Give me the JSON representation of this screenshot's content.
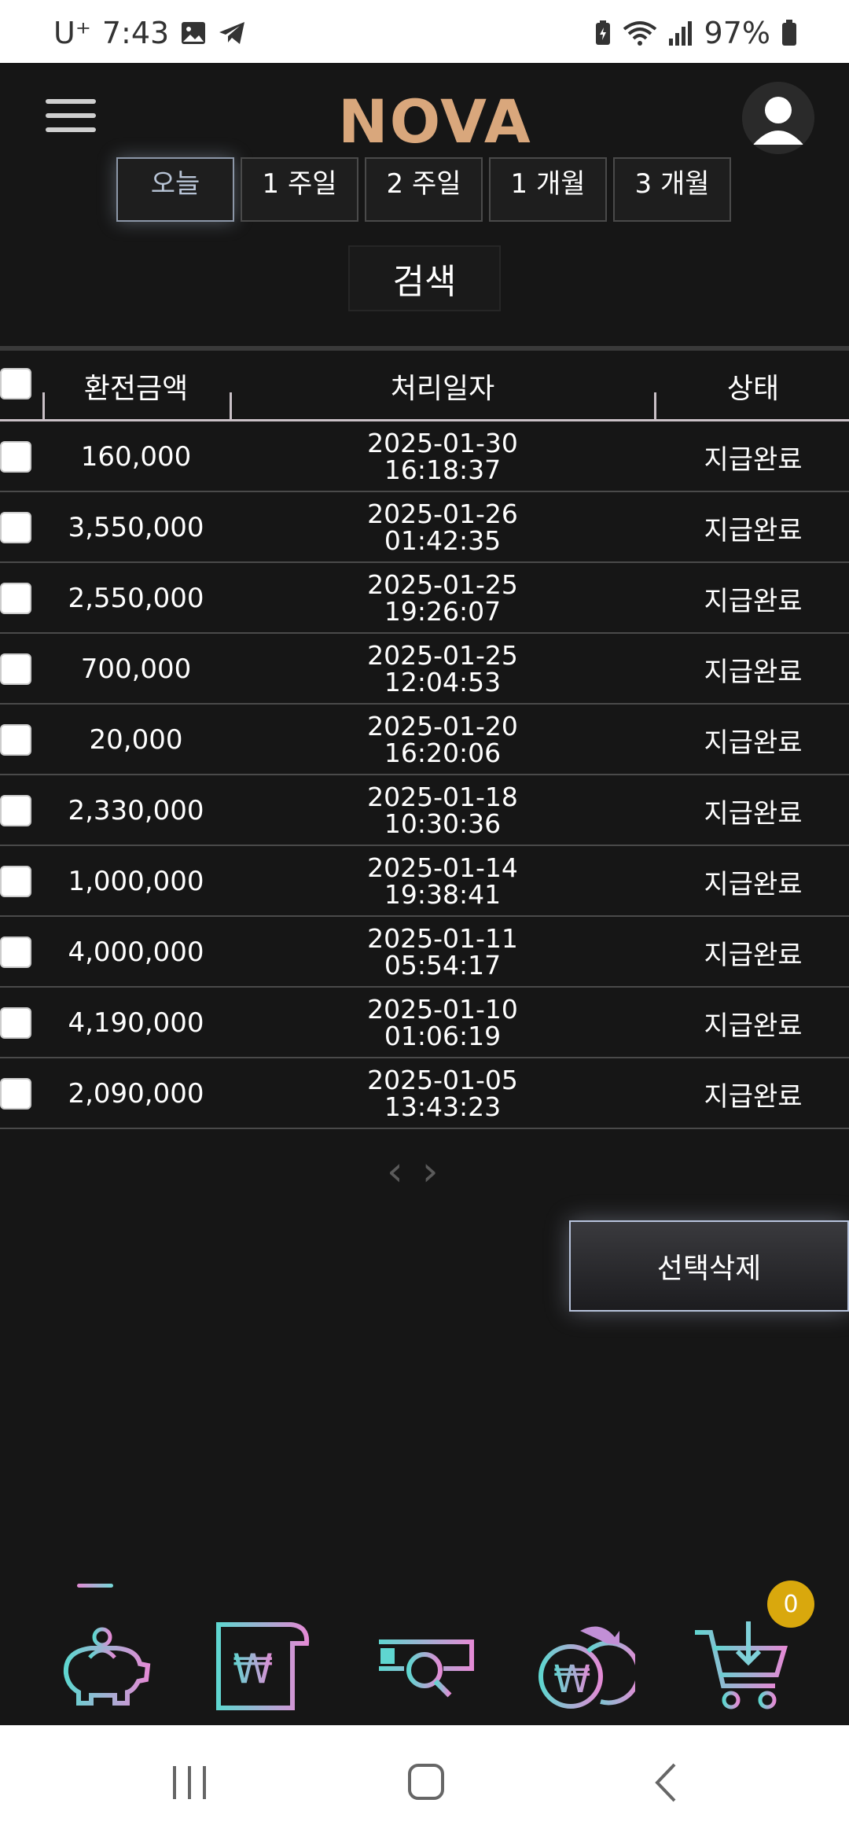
{
  "status_bar": {
    "carrier": "U⁺",
    "time": "7:43",
    "battery": "97%"
  },
  "header": {
    "logo_text": "NOVA"
  },
  "period_buttons": [
    "오늘",
    "1 주일",
    "2 주일",
    "1 개월",
    "3 개월"
  ],
  "search_label": "검색",
  "table": {
    "headers": {
      "amount": "환전금액",
      "date": "처리일자",
      "status": "상태"
    },
    "rows": [
      {
        "amount": "160,000",
        "date": "2025-01-30",
        "time": "16:18:37",
        "status": "지급완료"
      },
      {
        "amount": "3,550,000",
        "date": "2025-01-26",
        "time": "01:42:35",
        "status": "지급완료"
      },
      {
        "amount": "2,550,000",
        "date": "2025-01-25",
        "time": "19:26:07",
        "status": "지급완료"
      },
      {
        "amount": "700,000",
        "date": "2025-01-25",
        "time": "12:04:53",
        "status": "지급완료"
      },
      {
        "amount": "20,000",
        "date": "2025-01-20",
        "time": "16:20:06",
        "status": "지급완료"
      },
      {
        "amount": "2,330,000",
        "date": "2025-01-18",
        "time": "10:30:36",
        "status": "지급완료"
      },
      {
        "amount": "1,000,000",
        "date": "2025-01-14",
        "time": "19:38:41",
        "status": "지급완료"
      },
      {
        "amount": "4,000,000",
        "date": "2025-01-11",
        "time": "05:54:17",
        "status": "지급완료"
      },
      {
        "amount": "4,190,000",
        "date": "2025-01-10",
        "time": "01:06:19",
        "status": "지급완료"
      },
      {
        "amount": "2,090,000",
        "date": "2025-01-05",
        "time": "13:43:23",
        "status": "지급완료"
      }
    ]
  },
  "pager": {
    "prev": "‹",
    "next": "›"
  },
  "delete_label": "선택삭제",
  "cart_count": "0",
  "icons": [
    "piggy-bank-icon",
    "won-document-icon",
    "search-ticket-icon",
    "won-coins-exchange-icon",
    "cart-download-icon"
  ],
  "colors": {
    "accent_teal": "#5fd6d0",
    "accent_pink": "#e38bd5",
    "logo_gold": "#d9a77c",
    "badge_gold": "#d9a80d"
  }
}
